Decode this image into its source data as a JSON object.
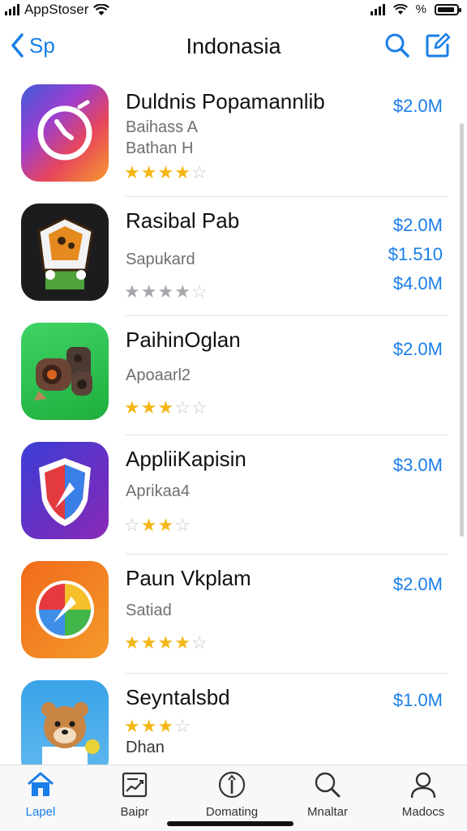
{
  "status_bar": {
    "carrier": "AppStoser",
    "battery_label": "%"
  },
  "nav": {
    "back_label": "Sp",
    "title": "Indonasia"
  },
  "apps": [
    {
      "name": "Duldnis Popamannlib",
      "subtitle1": "Baihass A",
      "subtitle2": "Bathan H",
      "rating": 3.5,
      "prices": [
        "$2.0M"
      ]
    },
    {
      "name": "Rasibal Pab",
      "subtitle1": "Sapukard",
      "rating": 4,
      "prices": [
        "$2.0M",
        "$1.510",
        "$4.0M"
      ]
    },
    {
      "name": "PaihinOglan",
      "subtitle1": "Apoaarl2",
      "rating": 3.5,
      "prices": [
        "$2.0M"
      ]
    },
    {
      "name": "AppliiKapisin",
      "subtitle1": "Aprikaa4",
      "rating": 2.5,
      "prices": [
        "$3.0M"
      ]
    },
    {
      "name": "Paun Vkplam",
      "subtitle1": "Satiad",
      "rating": 4,
      "prices": [
        "$2.0M"
      ]
    },
    {
      "name": "Seyntalsbd",
      "subtitle1": "Dhan",
      "rating": 3.5,
      "prices": [
        "$1.0M"
      ]
    }
  ],
  "tabs": [
    {
      "label": "Lapel",
      "icon": "home-icon",
      "active": true
    },
    {
      "label": "Baipr",
      "icon": "chart-icon"
    },
    {
      "label": "Domating",
      "icon": "info-icon"
    },
    {
      "label": "Mnaltar",
      "icon": "search-icon"
    },
    {
      "label": "Madocs",
      "icon": "person-icon"
    }
  ],
  "colors": {
    "accent": "#1a7ee8",
    "star": "#f5b716"
  }
}
